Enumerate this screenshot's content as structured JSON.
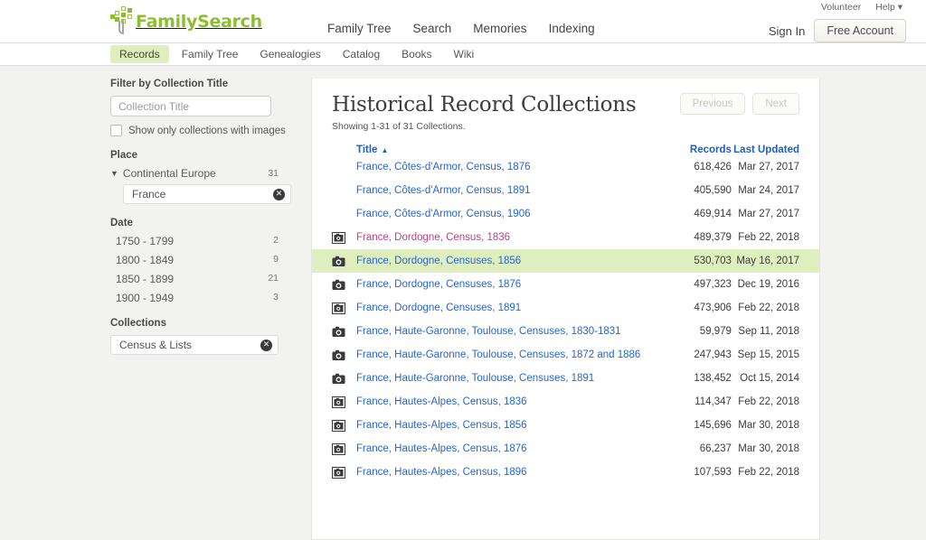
{
  "header": {
    "brand": "FamilySearch",
    "main_nav": [
      "Family Tree",
      "Search",
      "Memories",
      "Indexing"
    ],
    "util_nav": [
      "Volunteer",
      "Help ▾"
    ],
    "sign_in": "Sign In",
    "free_account": "Free Account"
  },
  "subnav": {
    "items": [
      "Records",
      "Family Tree",
      "Genealogies",
      "Catalog",
      "Books",
      "Wiki"
    ],
    "active": "Records"
  },
  "sidebar": {
    "filter_title_heading": "Filter by Collection Title",
    "collection_title_placeholder": "Collection Title",
    "images_checkbox_label": "Show only collections with images",
    "place_heading": "Place",
    "place_parent": "Continental Europe",
    "place_parent_count": "31",
    "place_selected": "France",
    "date_heading": "Date",
    "dates": [
      {
        "range": "1750 - 1799",
        "count": "2"
      },
      {
        "range": "1800 - 1849",
        "count": "9"
      },
      {
        "range": "1850 - 1899",
        "count": "21"
      },
      {
        "range": "1900 - 1949",
        "count": "3"
      }
    ],
    "collections_heading": "Collections",
    "collection_selected": "Census & Lists"
  },
  "main": {
    "title": "Historical Record Collections",
    "showing": "Showing 1-31 of 31 Collections.",
    "previous": "Previous",
    "next": "Next",
    "columns": {
      "title": "Title",
      "records": "Records",
      "updated": "Last Updated"
    },
    "sort_indicator": "▲",
    "rows": [
      {
        "title": "France, Côtes-d'Armor, Census, 1876",
        "records": "618,426",
        "updated": "Mar 27, 2017",
        "icon": "none",
        "visited": false,
        "highlighted": false
      },
      {
        "title": "France, Côtes-d'Armor, Census, 1891",
        "records": "405,590",
        "updated": "Mar 24, 2017",
        "icon": "none",
        "visited": false,
        "highlighted": false
      },
      {
        "title": "France, Côtes-d'Armor, Census, 1906",
        "records": "469,914",
        "updated": "Mar 27, 2017",
        "icon": "none",
        "visited": false,
        "highlighted": false
      },
      {
        "title": "France, Dordogne, Census, 1836",
        "records": "489,379",
        "updated": "Feb 22, 2018",
        "icon": "camera-framed",
        "visited": true,
        "highlighted": false
      },
      {
        "title": "France, Dordogne, Censuses, 1856",
        "records": "530,703",
        "updated": "May 16, 2017",
        "icon": "camera",
        "visited": false,
        "highlighted": true
      },
      {
        "title": "France, Dordogne, Censuses, 1876",
        "records": "497,323",
        "updated": "Dec 19, 2016",
        "icon": "camera",
        "visited": false,
        "highlighted": false
      },
      {
        "title": "France, Dordogne, Censuses, 1891",
        "records": "473,906",
        "updated": "Feb 22, 2018",
        "icon": "camera-framed",
        "visited": false,
        "highlighted": false
      },
      {
        "title": "France, Haute-Garonne, Toulouse, Censuses, 1830-1831",
        "records": "59,979",
        "updated": "Sep 11, 2018",
        "icon": "camera",
        "visited": false,
        "highlighted": false
      },
      {
        "title": "France, Haute-Garonne, Toulouse, Censuses, 1872 and 1886",
        "records": "247,943",
        "updated": "Sep 15, 2015",
        "icon": "camera",
        "visited": false,
        "highlighted": false
      },
      {
        "title": "France, Haute-Garonne, Toulouse, Censuses, 1891",
        "records": "138,452",
        "updated": "Oct 15, 2014",
        "icon": "camera",
        "visited": false,
        "highlighted": false
      },
      {
        "title": "France, Hautes-Alpes, Census, 1836",
        "records": "114,347",
        "updated": "Feb 22, 2018",
        "icon": "camera-framed",
        "visited": false,
        "highlighted": false
      },
      {
        "title": "France, Hautes-Alpes, Census, 1856",
        "records": "145,696",
        "updated": "Mar 30, 2018",
        "icon": "camera-framed",
        "visited": false,
        "highlighted": false
      },
      {
        "title": "France, Hautes-Alpes, Census, 1876",
        "records": "66,237",
        "updated": "Mar 30, 2018",
        "icon": "camera-framed",
        "visited": false,
        "highlighted": false
      },
      {
        "title": "France, Hautes-Alpes, Census, 1896",
        "records": "107,593",
        "updated": "Feb 22, 2018",
        "icon": "camera-framed",
        "visited": false,
        "highlighted": false
      }
    ]
  },
  "colors": {
    "brand_green": "#8cbf2f",
    "link_blue": "#2566cf",
    "visited_link": "#b8457f",
    "highlight_row": "#dfeebf",
    "active_tab": "#dfedbf"
  }
}
